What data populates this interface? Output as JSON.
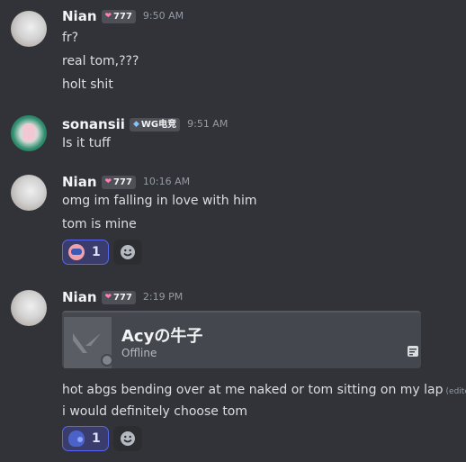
{
  "messages": [
    {
      "username": "Nian",
      "tag": "777",
      "time": "9:50 AM",
      "lines": [
        "fr?",
        "real tom,???",
        "holt shit"
      ]
    },
    {
      "username": "sonansii",
      "tag": "WG电竞",
      "time": "9:51 AM",
      "lines": [
        "Is it tuff"
      ]
    },
    {
      "username": "Nian",
      "tag": "777",
      "time": "10:16 AM",
      "lines": [
        "omg im falling in love with him",
        "tom is mine"
      ],
      "reaction": {
        "emoji": "cat-face-emoji",
        "count": "1"
      }
    },
    {
      "username": "Nian",
      "tag": "777",
      "time": "2:19 PM",
      "embed": {
        "name": "Acyの牛子",
        "status": "Offline"
      },
      "lines": [
        "hot abgs bending over at me naked or tom sitting on my lap",
        "i would definitely choose tom"
      ],
      "edited": "(edited)",
      "reaction": {
        "emoji": "speaking-head-emoji",
        "count": "1"
      }
    }
  ],
  "colors": {
    "background": "#313338",
    "reaction_active_bg": "#3a3c6b",
    "reaction_active_border": "#5865f2"
  }
}
